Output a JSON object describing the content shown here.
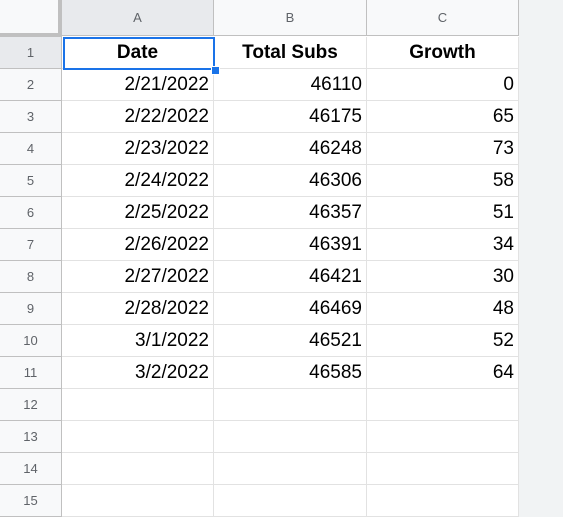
{
  "columns": [
    "A",
    "B",
    "C"
  ],
  "rows": [
    "1",
    "2",
    "3",
    "4",
    "5",
    "6",
    "7",
    "8",
    "9",
    "10",
    "11",
    "12",
    "13",
    "14",
    "15"
  ],
  "headers": [
    "Date",
    "Total Subs",
    "Growth"
  ],
  "data": [
    [
      "2/21/2022",
      "46110",
      "0"
    ],
    [
      "2/22/2022",
      "46175",
      "65"
    ],
    [
      "2/23/2022",
      "46248",
      "73"
    ],
    [
      "2/24/2022",
      "46306",
      "58"
    ],
    [
      "2/25/2022",
      "46357",
      "51"
    ],
    [
      "2/26/2022",
      "46391",
      "34"
    ],
    [
      "2/27/2022",
      "46421",
      "30"
    ],
    [
      "2/28/2022",
      "46469",
      "48"
    ],
    [
      "3/1/2022",
      "46521",
      "52"
    ],
    [
      "3/2/2022",
      "46585",
      "64"
    ]
  ],
  "selected_cell": "A1",
  "accent": "#1a73e8"
}
